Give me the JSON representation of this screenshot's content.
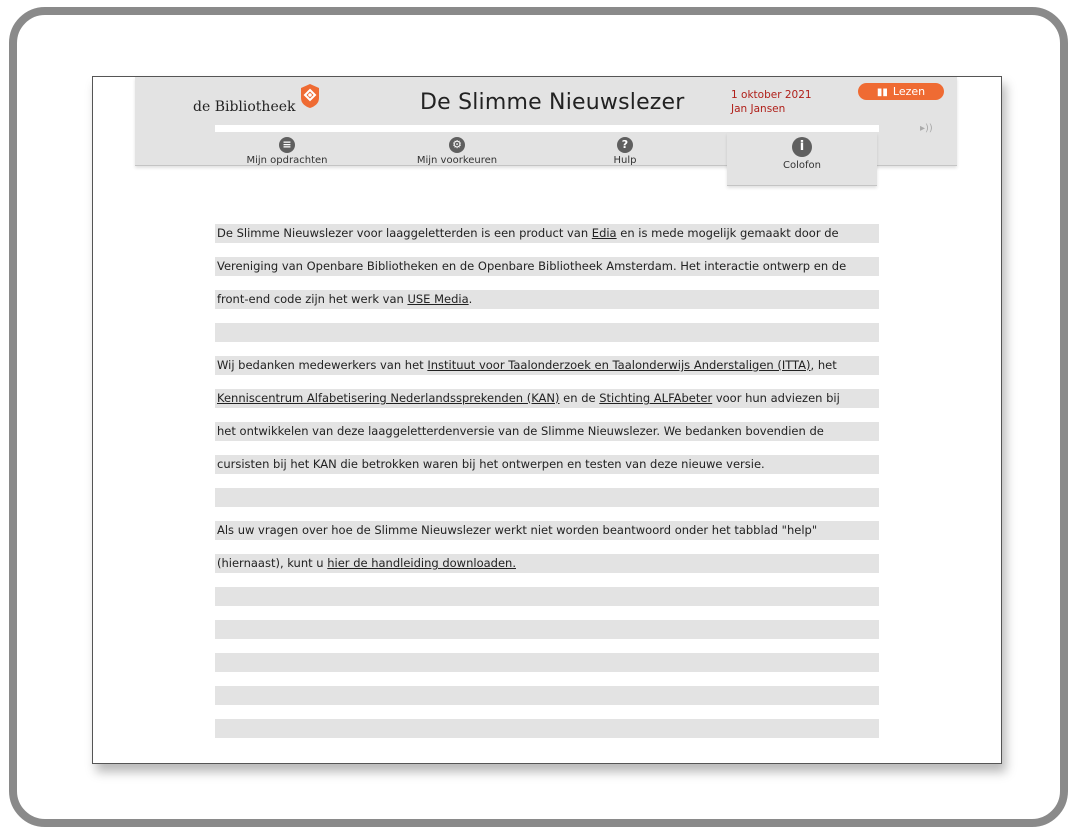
{
  "header": {
    "logo_text": "de Bibliotheek",
    "title": "De Slimme Nieuwslezer",
    "date": "1 oktober 2021",
    "user": "Jan Jansen",
    "read_button": "Lezen"
  },
  "tabs": [
    {
      "label": "Mijn opdrachten",
      "icon": "book-icon"
    },
    {
      "label": "Mijn voorkeuren",
      "icon": "gear-icon"
    },
    {
      "label": "Hulp",
      "icon": "question-icon"
    },
    {
      "label": "Colofon",
      "icon": "info-icon",
      "active": true
    }
  ],
  "content": {
    "p1_l1a": "De Slimme Nieuwslezer voor laaggeletterden is een product van ",
    "p1_l1link": "Edia",
    "p1_l1b": " en is mede mogelijk gemaakt door de",
    "p1_l2": "Vereniging van Openbare Bibliotheken en de Openbare Bibliotheek Amsterdam. Het interactie ontwerp en de",
    "p1_l3a": "front-end code zijn het werk van ",
    "p1_l3link": "USE Media",
    "p1_l3b": ".",
    "p2_l1a": "Wij bedanken medewerkers van het ",
    "p2_l1link": "Instituut voor Taalonderzoek en Taalonderwijs Anderstaligen (ITTA)",
    "p2_l1b": ", het",
    "p2_l2link1": "Kenniscentrum Alfabetisering Nederlandssprekenden (KAN)",
    "p2_l2mid": " en de ",
    "p2_l2link2": "Stichting ALFAbeter",
    "p2_l2b": " voor hun adviezen bij",
    "p2_l3": "het ontwikkelen van deze laaggeletterdenversie van de Slimme Nieuwslezer. We bedanken bovendien de",
    "p2_l4": "cursisten bij het KAN die betrokken waren bij het ontwerpen en testen van deze nieuwe versie.",
    "p3_l1": "Als uw vragen over hoe de Slimme Nieuwslezer werkt niet worden beantwoord onder het tabblad \"help\"",
    "p3_l2a": "(hiernaast), kunt u ",
    "p3_l2link": "hier de handleiding downloaden."
  },
  "colors": {
    "accent": "#ef6b33",
    "meta_text": "#b0201a",
    "line_bg": "#e3e3e3"
  }
}
